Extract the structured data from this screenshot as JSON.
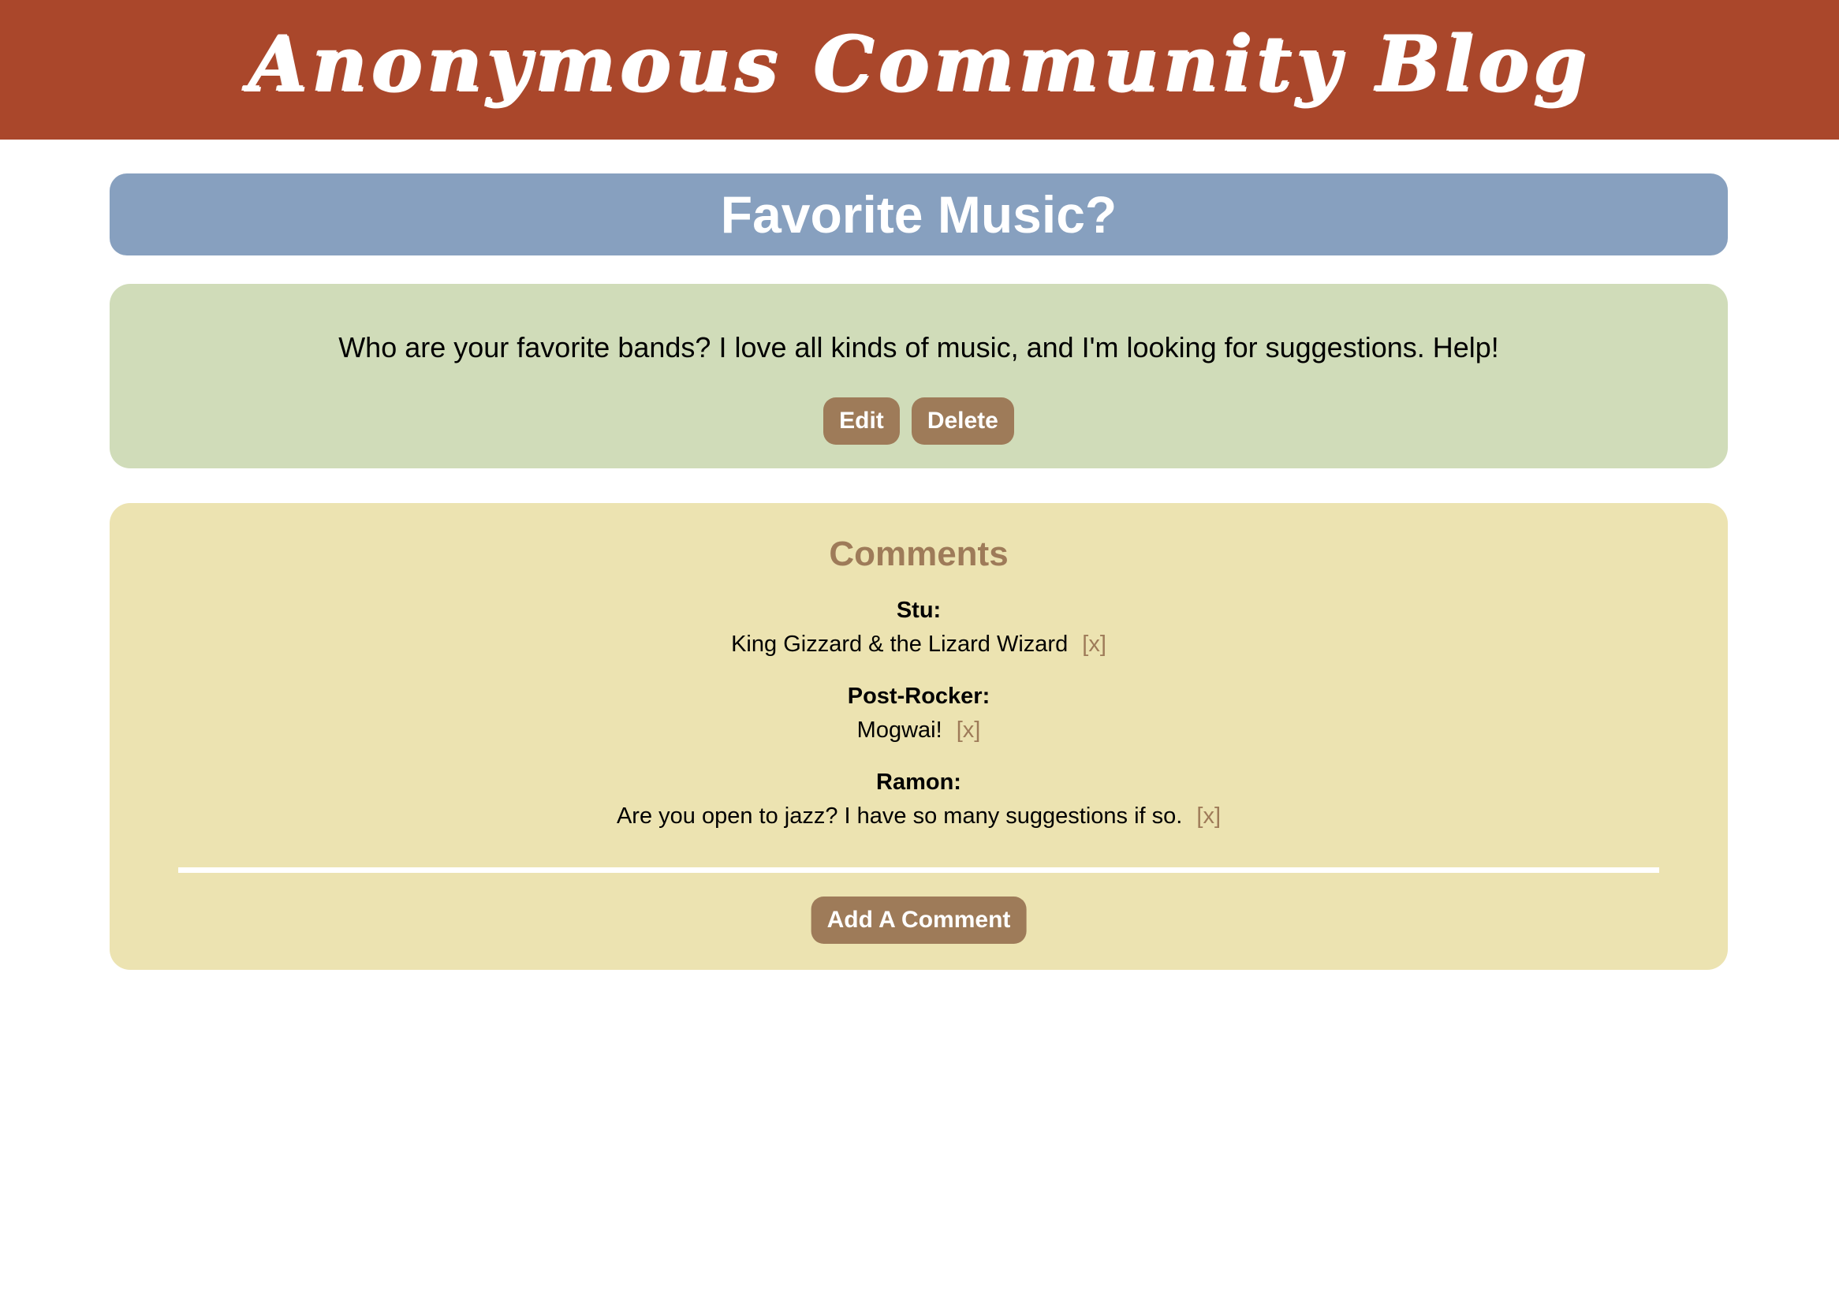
{
  "header": {
    "site_title": "Anonymous Community Blog"
  },
  "post": {
    "title": "Favorite Music?",
    "body": "Who are your favorite bands? I love all kinds of music, and I'm looking for suggestions. Help!",
    "edit_label": "Edit",
    "delete_label": "Delete"
  },
  "comments": {
    "heading": "Comments",
    "items": [
      {
        "author": "Stu:",
        "text": "King Gizzard & the Lizard Wizard",
        "delete_label": "[x]"
      },
      {
        "author": "Post-Rocker:",
        "text": "Mogwai!",
        "delete_label": "[x]"
      },
      {
        "author": "Ramon:",
        "text": "Are you open to jazz? I have so many suggestions if so.",
        "delete_label": "[x]"
      }
    ],
    "add_label": "Add A Comment"
  },
  "colors": {
    "header_bg": "#aa472b",
    "title_bar_bg": "#87a0bf",
    "post_bg": "#d0dcb9",
    "comments_bg": "#ece3b1",
    "button_bg": "#9e7b59"
  }
}
